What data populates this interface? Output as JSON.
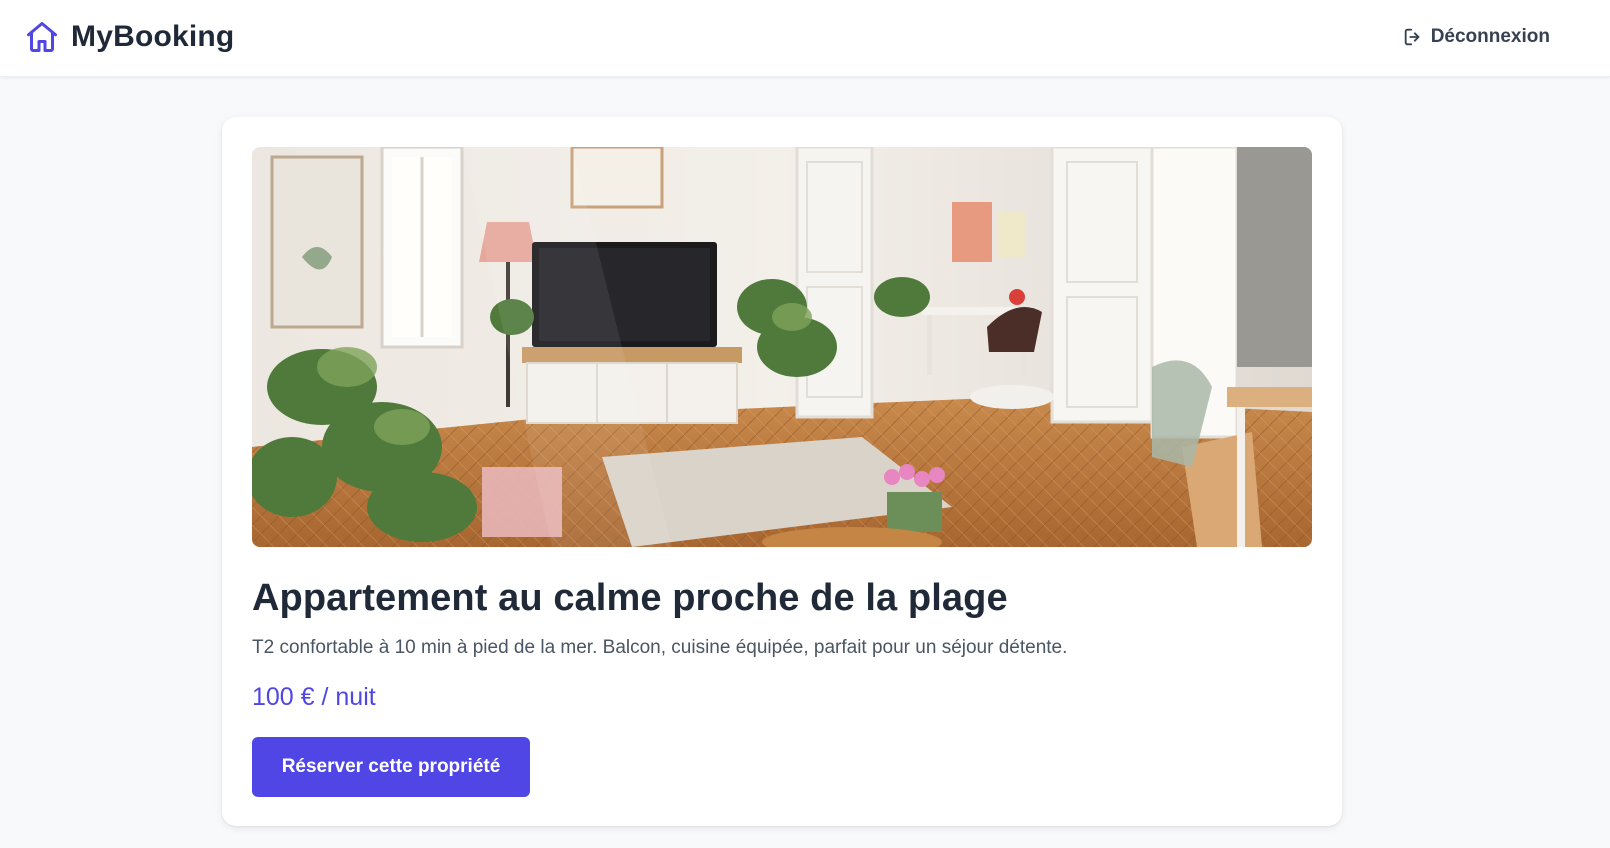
{
  "header": {
    "brand_name": "MyBooking",
    "brand_icon": "home-icon",
    "logout_label": "Déconnexion",
    "logout_icon": "logout-icon"
  },
  "property": {
    "image_alt": "Salon lumineux avec plantes, télévision, parquet en chevrons et bureau",
    "title": "Appartement au calme proche de la plage",
    "description": "T2 confortable à 10 min à pied de la mer. Balcon, cuisine équipée, parfait pour un séjour détente.",
    "price": "100 € / nuit",
    "reserve_label": "Réserver cette propriété"
  },
  "colors": {
    "accent": "#4f46e5",
    "text": "#1f2937",
    "muted": "#4b5563",
    "background": "#f8f9fb"
  }
}
